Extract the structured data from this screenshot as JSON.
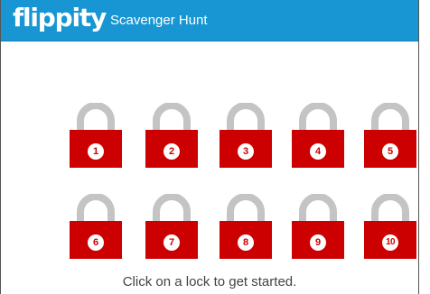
{
  "header": {
    "logo": "flippity",
    "title": "Scavenger Hunt"
  },
  "locks": [
    {
      "label": "1"
    },
    {
      "label": "2"
    },
    {
      "label": "3"
    },
    {
      "label": "4"
    },
    {
      "label": "5"
    },
    {
      "label": "6"
    },
    {
      "label": "7"
    },
    {
      "label": "8"
    },
    {
      "label": "9"
    },
    {
      "label": "10"
    }
  ],
  "instructions": "Click on a lock to get started.",
  "colors": {
    "header": "#1796d3",
    "lock_body": "#cc0000",
    "shackle": "#c4c4c4"
  },
  "icons": {
    "lock": "padlock-icon"
  }
}
